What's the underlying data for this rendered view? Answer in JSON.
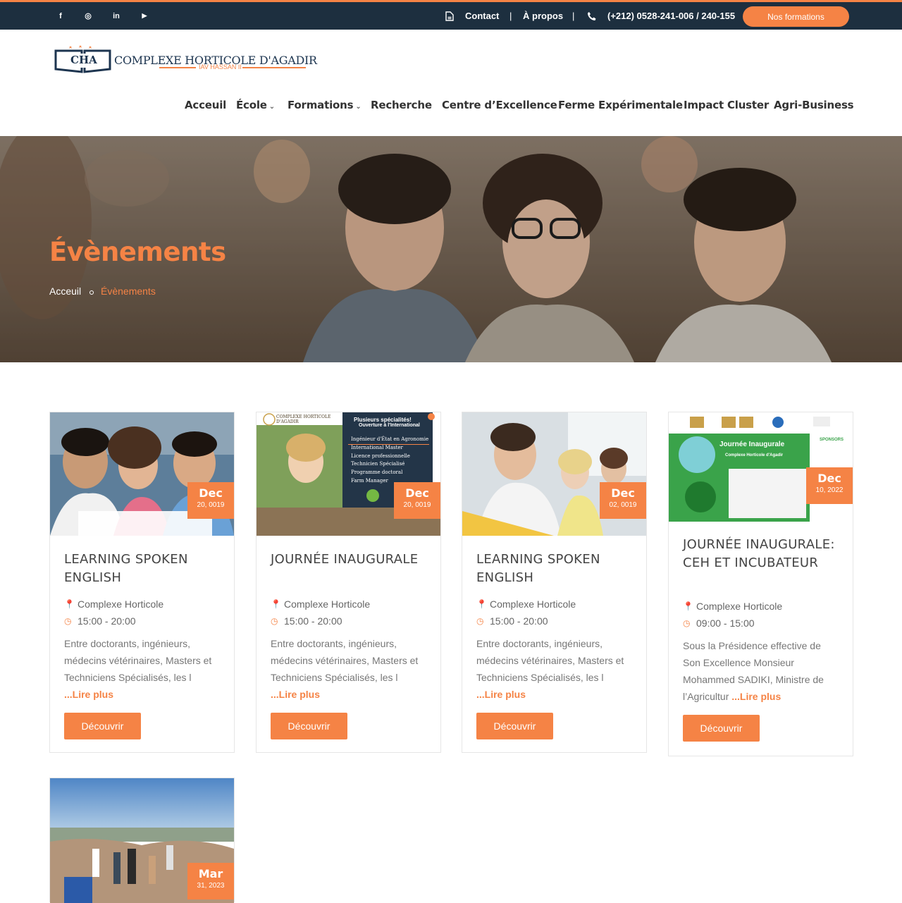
{
  "topbar": {
    "social": [
      {
        "icon": "facebook-icon",
        "glyph": "f"
      },
      {
        "icon": "instagram-icon",
        "glyph": "◎"
      },
      {
        "icon": "linkedin-icon",
        "glyph": "in"
      },
      {
        "icon": "youtube-icon",
        "glyph": "▶"
      }
    ],
    "contact_label": "Contact",
    "sep1": "|",
    "about_label": "À propos",
    "sep2": "|",
    "phone": "(+212) 0528-241-006 / 240-155",
    "cta_label": "Nos formations"
  },
  "logo": {
    "badge": "CHA",
    "name": "COMPLEXE HORTICOLE D'AGADIR",
    "sub": "IAV HASSAN II"
  },
  "nav": {
    "items": [
      "Acceuil",
      "École",
      "Formations",
      "Recherche",
      "Centre d’Excellence",
      "Ferme Expérimentale",
      "Impact Cluster",
      "Agri-Business"
    ]
  },
  "hero": {
    "title": "Évènements",
    "crumb_home": "Acceuil",
    "crumb_current": "Évènements"
  },
  "events": [
    {
      "title": "LEARNING SPOKEN ENGLISH",
      "month": "Dec",
      "day": "20, 0019",
      "place": "Complexe Horticole",
      "time": "15:00 - 20:00",
      "excerpt": "Entre doctorants, ingénieurs, médecins vétérinaires, Masters et Techniciens Spécialisés, les l",
      "more": "...Lire plus",
      "button": "Découvrir"
    },
    {
      "title": "JOURNÉE INAUGURALE",
      "month": "Dec",
      "day": "20, 0019",
      "place": "Complexe Horticole",
      "time": "15:00 - 20:00",
      "excerpt": "Entre doctorants, ingénieurs, médecins vétérinaires, Masters et Techniciens Spécialisés, les l",
      "more": "...Lire plus",
      "button": "Découvrir"
    },
    {
      "title": "LEARNING SPOKEN ENGLISH",
      "month": "Dec",
      "day": "02, 0019",
      "place": "Complexe Horticole",
      "time": "15:00 - 20:00",
      "excerpt": "Entre doctorants, ingénieurs, médecins vétérinaires, Masters et Techniciens Spécialisés, les l",
      "more": "...Lire plus",
      "button": "Découvrir"
    },
    {
      "title": "JOURNÉE INAUGURALE: CEH ET INCUBATEUR",
      "month": "Dec",
      "day": "10, 2022",
      "place": "Complexe Horticole",
      "time": "09:00 - 15:00",
      "excerpt": "Sous la Présidence effective de Son Excellence Monsieur Mohammed SADIKI, Ministre de l’Agricultur",
      "more": "...Lire plus",
      "button": "Découvrir"
    },
    {
      "title": "",
      "month": "Mar",
      "day": "31, 2023",
      "place": "",
      "time": "",
      "excerpt": "",
      "more": "",
      "button": ""
    }
  ],
  "poster": {
    "header": "COMPLEXE HORTICOLE D'AGADIR",
    "tag1": "Plusieurs spécialités!",
    "tag2": "Ouverture à l'International",
    "items": [
      "Ingénieur d'État en Agronomie",
      "International Master",
      "Licence professionnelle",
      "Technicien Spécialisé",
      "Programme doctoral",
      "Farm Manager"
    ]
  },
  "inaug": {
    "title": "Journée Inaugurale",
    "sub": "Complexe Horticole d'Agadir",
    "sponsors": "SPONSORS"
  },
  "colors": {
    "accent": "#f58345",
    "topbar": "#1d2f3f"
  }
}
